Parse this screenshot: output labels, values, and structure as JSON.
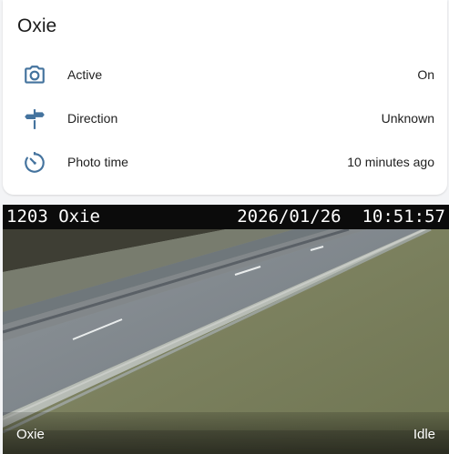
{
  "card": {
    "title": "Oxie",
    "rows": [
      {
        "icon": "camera-icon",
        "label": "Active",
        "value": "On"
      },
      {
        "icon": "direction-sign-icon",
        "label": "Direction",
        "value": "Unknown"
      },
      {
        "icon": "timer-icon",
        "label": "Photo time",
        "value": "10 minutes ago"
      }
    ]
  },
  "camera": {
    "osd_left": "1203 Oxie",
    "osd_date": "2026/01/26",
    "osd_time": "10:51:57",
    "caption_name": "Oxie",
    "caption_state": "Idle"
  },
  "colors": {
    "icon": "#44739e",
    "card_bg": "#ffffff",
    "page_bg": "#f3f4f6"
  }
}
